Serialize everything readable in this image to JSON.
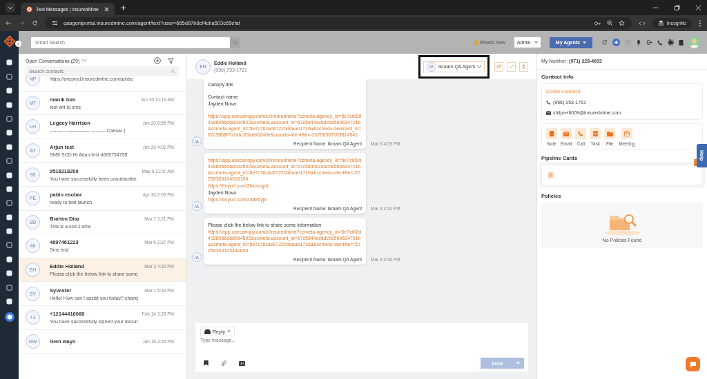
{
  "browser": {
    "tab_title": "Text Messages | InsuredMine",
    "url": "qaagentportal.insuredmine.com/agent/text?user=665d87b8cf4cba503c65efaf",
    "profile_label": "Incognito"
  },
  "header": {
    "search_placeholder": "Smart Search",
    "whats_new": "What's New",
    "role": "Admin",
    "agents_button": "My Agents"
  },
  "conversations": {
    "title": "Open Conversations (29)",
    "search_placeholder": "Search contacts",
    "items": [
      {
        "initials": "NP",
        "preview": "https://preprod.insuredmine.com/api/so",
        "selected": false
      },
      {
        "initials": "MT",
        "name": "manik tom",
        "time": "Jun 30 11:19 AM",
        "preview": "test wrt to sms",
        "selected": false
      },
      {
        "initials": "LH",
        "name": "Legacy Harrison",
        "time": "Jun 20 6:55 PM",
        "preview": "---------- -------------- --------- Caesar (",
        "selected": false
      },
      {
        "initials": "AT",
        "name": "Arjun test",
        "time": "Jun 20 4:02 PM",
        "preview": "SMS SCD Hi Arjun test 4695754755",
        "selected": false
      },
      {
        "initials": "95",
        "name": "9516218200",
        "time": "May 9 11:00 AM",
        "preview": "You have successfully been unsubscribe",
        "selected": false
      },
      {
        "initials": "PE",
        "name": "pablo esobar",
        "time": "Apr 30 2:09 PM",
        "preview": "ready to test launch",
        "selected": false
      },
      {
        "initials": "BD",
        "name": "Brahim Diaz",
        "time": "Mar 7 3:21 PM",
        "preview": "This is a scd 2 sms",
        "selected": false
      },
      {
        "initials": "46",
        "name": "4697461223",
        "time": "Mar 6 2:37 PM",
        "preview": "Sms test",
        "selected": false
      },
      {
        "initials": "EH",
        "name": "Eddie Holland",
        "time": "Mar 3 4:30 PM",
        "preview": "Please click the below link to share some",
        "selected": true
      },
      {
        "initials": "SY",
        "name": "Syvester",
        "time": "Mar 1 5:30 PM",
        "preview": "Hello! How can I assist you today? chang",
        "selected": false
      },
      {
        "initials": "+1",
        "name": "+12144416068",
        "time": "Feb 14 3:28 PM",
        "preview": "You have successfully signed your docun",
        "selected": false
      },
      {
        "initials": "GW",
        "name": "Glen wayn",
        "time": "Jan 18 3:26 PM",
        "selected": false
      }
    ]
  },
  "chat": {
    "contact_initials": "EH",
    "contact_name": "Eddie Holland",
    "contact_phone": "(956) 253-1761",
    "agent_initials": "IA",
    "agent_label": "Ikraam QA Agent",
    "messages": [
      {
        "sender_initials": "IA",
        "lines": [
          {
            "kind": "text",
            "text": "Canopy link"
          },
          {
            "kind": "spacer"
          },
          {
            "kind": "text",
            "text": "Contact name"
          },
          {
            "kind": "text",
            "text": "Jayden Nova"
          },
          {
            "kind": "spacer"
          },
          {
            "kind": "link",
            "text": "https://app.usecanopy.com/c/insuredmine?ccmeta-agency_id=5e7c6f2d4188056d6d0d4502&ccmeta-account_id=67c5844cc6dcb856b6347c1b&ccmeta-agent_id=5e7c76cac87220ddaab1716a&ccmeta-dealcard_id=67c5868f7b7abc63aeb6240e&ccmeta-identifier=20250303103814541"
          }
        ],
        "recipient": "Recipient Name: Ikraam QA Agent",
        "time": "Mar 3 4:09 PM"
      },
      {
        "sender_initials": "IA",
        "lines": [
          {
            "kind": "link",
            "text": "https://app.usecanopy.com/c/insuredmine?ccmeta-agency_id=5e7c6f2d4188056d6d0d4502&ccmeta-account_id=67c5844cc6dcb856b6347c1b&ccmeta-agent_id=5e7c76cac87220ddaab1716a&ccmeta-identifier=20250303104918194"
          },
          {
            "kind": "link",
            "text": "https://tinyurl.com/2bxmugdc"
          },
          {
            "kind": "text",
            "text": "Jayden Nova"
          },
          {
            "kind": "link",
            "text": "https://tinyurl.com/2a585yjb"
          }
        ],
        "recipient": "Recipient Name: Ikraam QA Agent",
        "time": "Mar 3 4:10 PM"
      },
      {
        "sender_initials": "IA",
        "lines": [
          {
            "kind": "text",
            "text": "Please click the below link to share some information"
          },
          {
            "kind": "link",
            "text": "https://app.usecanopy.com/c/insuredmine?ccmeta-agency_id=5e7c6f2d4188056d6d0d4502&ccmeta-account_id=67c5844cc6dcb856b6347c1b&ccmeta-agent_id=5e7c76cac87220ddaab1716a&ccmeta-identifier=20250303105442634"
          }
        ],
        "recipient": "Recipient Name: Ikraam QA Agent",
        "time": "Mar 3 4:30 PM"
      }
    ],
    "composer": {
      "mode": "Reply",
      "placeholder": "Type message...",
      "send": "Send",
      "send_disabled": true
    }
  },
  "contact_panel": {
    "my_number": "My Number: **(971) 328-4692**",
    "contact_info_title": "Contact info",
    "contact": {
      "name": "Eddie Holland",
      "phone": "(956) 253-1761",
      "email": "shilpa+6009@insuredmine.com"
    },
    "actions": [
      {
        "kind": "note",
        "label": "Note"
      },
      {
        "kind": "email",
        "label": "Email"
      },
      {
        "kind": "call",
        "label": "Call"
      },
      {
        "kind": "task",
        "label": "Task"
      },
      {
        "kind": "file",
        "label": "File"
      },
      {
        "kind": "meeting",
        "label": "Meeting"
      }
    ],
    "pipeline_title": "Pipeline Cards",
    "policies_title": "Policies",
    "policies_empty": "No Policies Found"
  },
  "help_tab": "Help"
}
